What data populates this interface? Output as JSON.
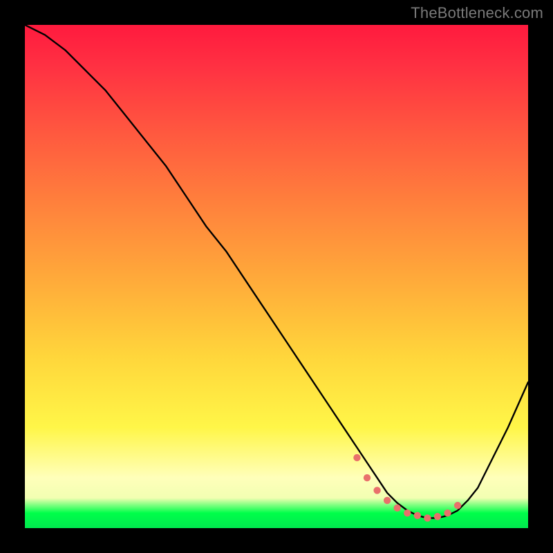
{
  "watermark": "TheBottleneck.com",
  "chart_data": {
    "type": "line",
    "title": "",
    "xlabel": "",
    "ylabel": "",
    "xlim": [
      0,
      100
    ],
    "ylim": [
      0,
      100
    ],
    "grid": false,
    "legend": false,
    "series": [
      {
        "name": "curve",
        "x": [
          0,
          4,
          8,
          12,
          16,
          20,
          24,
          28,
          32,
          36,
          40,
          44,
          48,
          52,
          56,
          60,
          64,
          66,
          68,
          70,
          72,
          74,
          76,
          78,
          80,
          82,
          84,
          86,
          88,
          90,
          92,
          96,
          100
        ],
        "y": [
          100,
          98,
          95,
          91,
          87,
          82,
          77,
          72,
          66,
          60,
          55,
          49,
          43,
          37,
          31,
          25,
          19,
          16,
          13,
          10,
          7,
          5,
          3.5,
          2.5,
          2,
          2,
          2.5,
          3.5,
          5.5,
          8,
          12,
          20,
          29
        ]
      }
    ],
    "flat_region_markers": {
      "x": [
        66,
        68,
        70,
        72,
        74,
        76,
        78,
        80,
        82,
        84,
        86
      ],
      "y": [
        14,
        10,
        7.5,
        5.5,
        4,
        3,
        2.5,
        2,
        2.3,
        3,
        4.5
      ]
    },
    "background_gradient": {
      "direction": "vertical",
      "stops": [
        {
          "pos": 0.0,
          "color": "#ff1a3e"
        },
        {
          "pos": 0.35,
          "color": "#ff823c"
        },
        {
          "pos": 0.66,
          "color": "#ffd63b"
        },
        {
          "pos": 0.9,
          "color": "#ffffba"
        },
        {
          "pos": 0.97,
          "color": "#00ff4a"
        },
        {
          "pos": 1.0,
          "color": "#00e84e"
        }
      ]
    }
  }
}
